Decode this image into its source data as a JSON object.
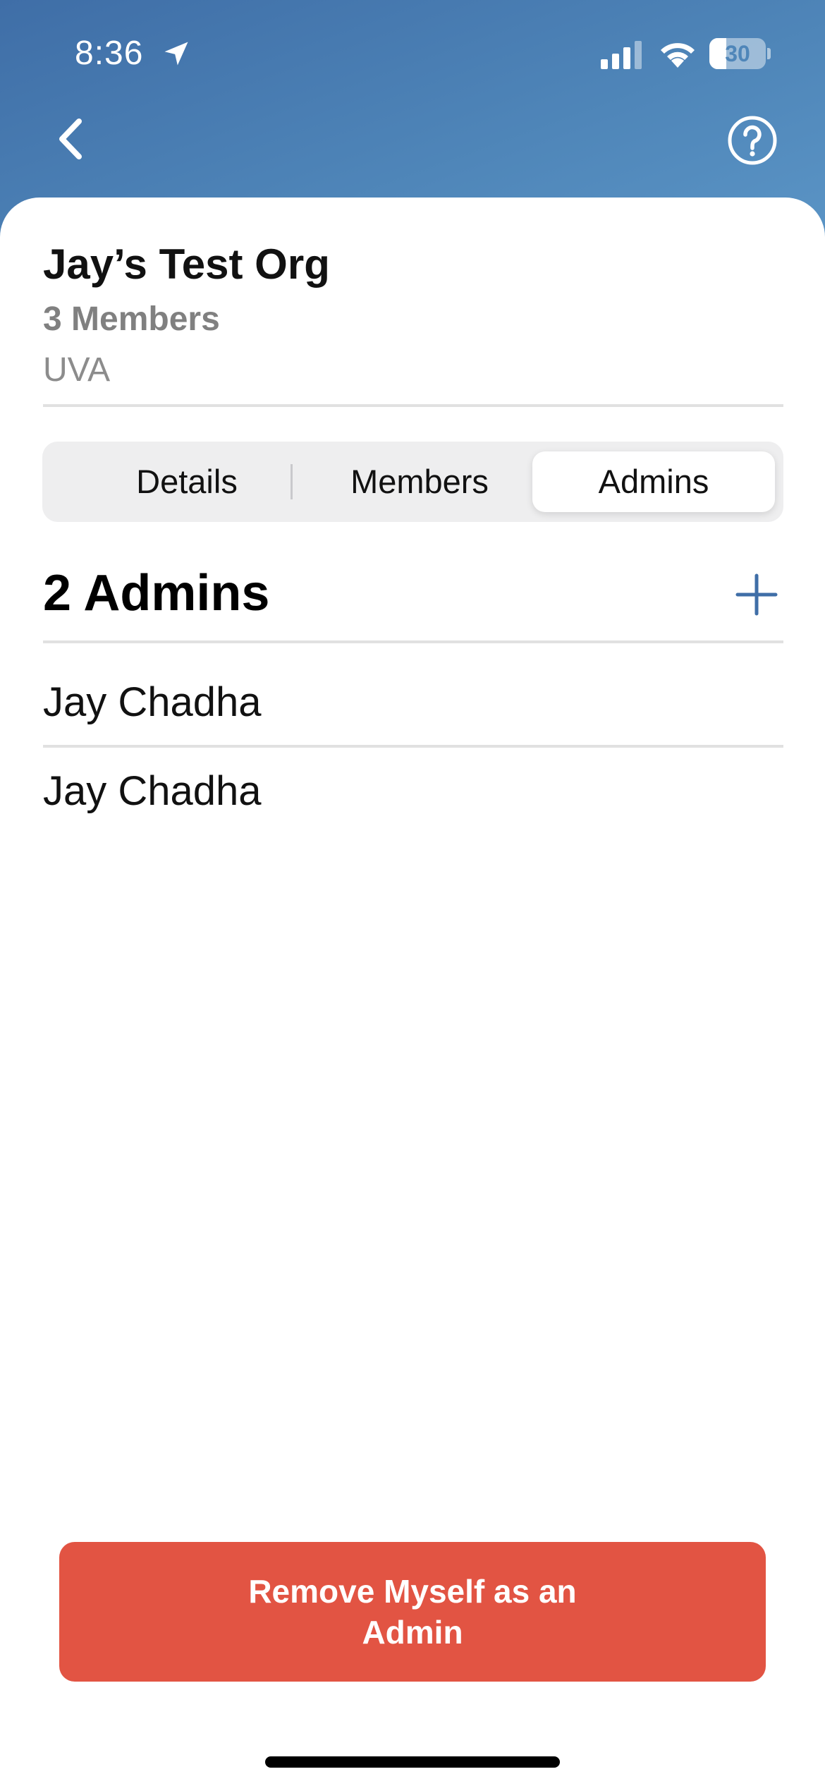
{
  "status_bar": {
    "time": "8:36",
    "battery_level": "30",
    "battery_fraction": 0.3,
    "icons": [
      "location-arrow-icon",
      "cellular-signal-icon",
      "wifi-icon",
      "battery-icon"
    ]
  },
  "nav": {
    "back_icon": "chevron-left-icon",
    "help_icon": "question-circle-icon"
  },
  "org": {
    "name": "Jay’s Test Org",
    "member_count": "3 Members",
    "school": "UVA"
  },
  "tabs": [
    {
      "label": "Details",
      "selected": false
    },
    {
      "label": "Members",
      "selected": false
    },
    {
      "label": "Admins",
      "selected": true
    }
  ],
  "admins": {
    "heading": "2 Admins",
    "add_icon": "plus-icon",
    "items": [
      {
        "name": "Jay Chadha"
      },
      {
        "name": "Jay Chadha"
      }
    ]
  },
  "actions": {
    "remove_label": "Remove Myself as an Admin"
  },
  "colors": {
    "header_gradient_start": "#3f6ea7",
    "header_gradient_end": "#5b95c6",
    "accent_blue": "#3f6ea7",
    "destructive_red": "#e25443",
    "divider": "#e1e1e1",
    "segment_bg": "#eeeeef"
  }
}
